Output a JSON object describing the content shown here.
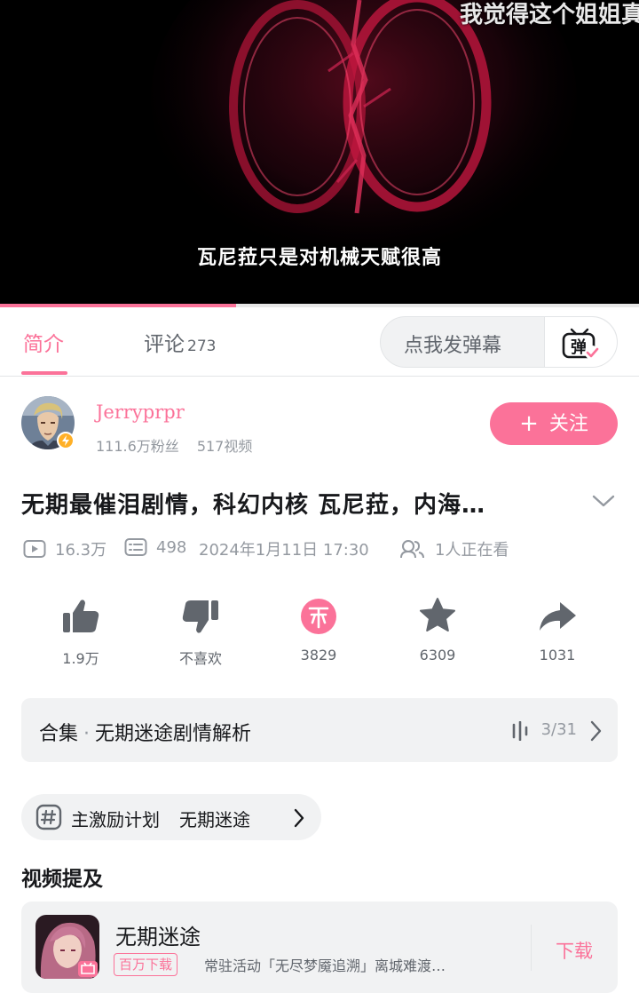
{
  "video": {
    "top_overlay_text": "我觉得这个姐姐真",
    "subtitle": "瓦尼菈只是对机械天赋很高",
    "playback_progress": 0.37
  },
  "tabs": {
    "intro": "简介",
    "comments": "评论",
    "comments_count": "273",
    "danmaku_placeholder": "点我发弹幕",
    "danmaku_icon_label": "弹"
  },
  "uploader": {
    "name": "Jerryprpr",
    "fans": "111.6万粉丝",
    "videos": "517视频",
    "follow_label": "关注",
    "follow_prefix": "+"
  },
  "video_info": {
    "title": "无期最催泪剧情，科幻内核 瓦尼菈，内海…",
    "views": "16.3万",
    "danmaku": "498",
    "date": "2024年1月11日 17:30",
    "watching": "1人正在看"
  },
  "actions": {
    "like": "1.9万",
    "dislike": "不喜欢",
    "coin": "3829",
    "favorite": "6309",
    "share": "1031"
  },
  "collection": {
    "prefix": "合集",
    "separator": "·",
    "name": "无期迷途剧情解析",
    "progress": "3/31"
  },
  "tags": {
    "item1": "主激励计划",
    "item2": "无期迷途"
  },
  "mentions": {
    "heading": "视频提及",
    "game_name": "无期迷途",
    "badge": "百万下载",
    "description": "常驻活动「无尽梦魇追溯」离城难渡…",
    "download_label": "下载"
  },
  "colors": {
    "accent": "#fb7299",
    "text_primary": "#18191c",
    "text_secondary": "#9499a0",
    "card_bg": "#f1f2f3"
  }
}
